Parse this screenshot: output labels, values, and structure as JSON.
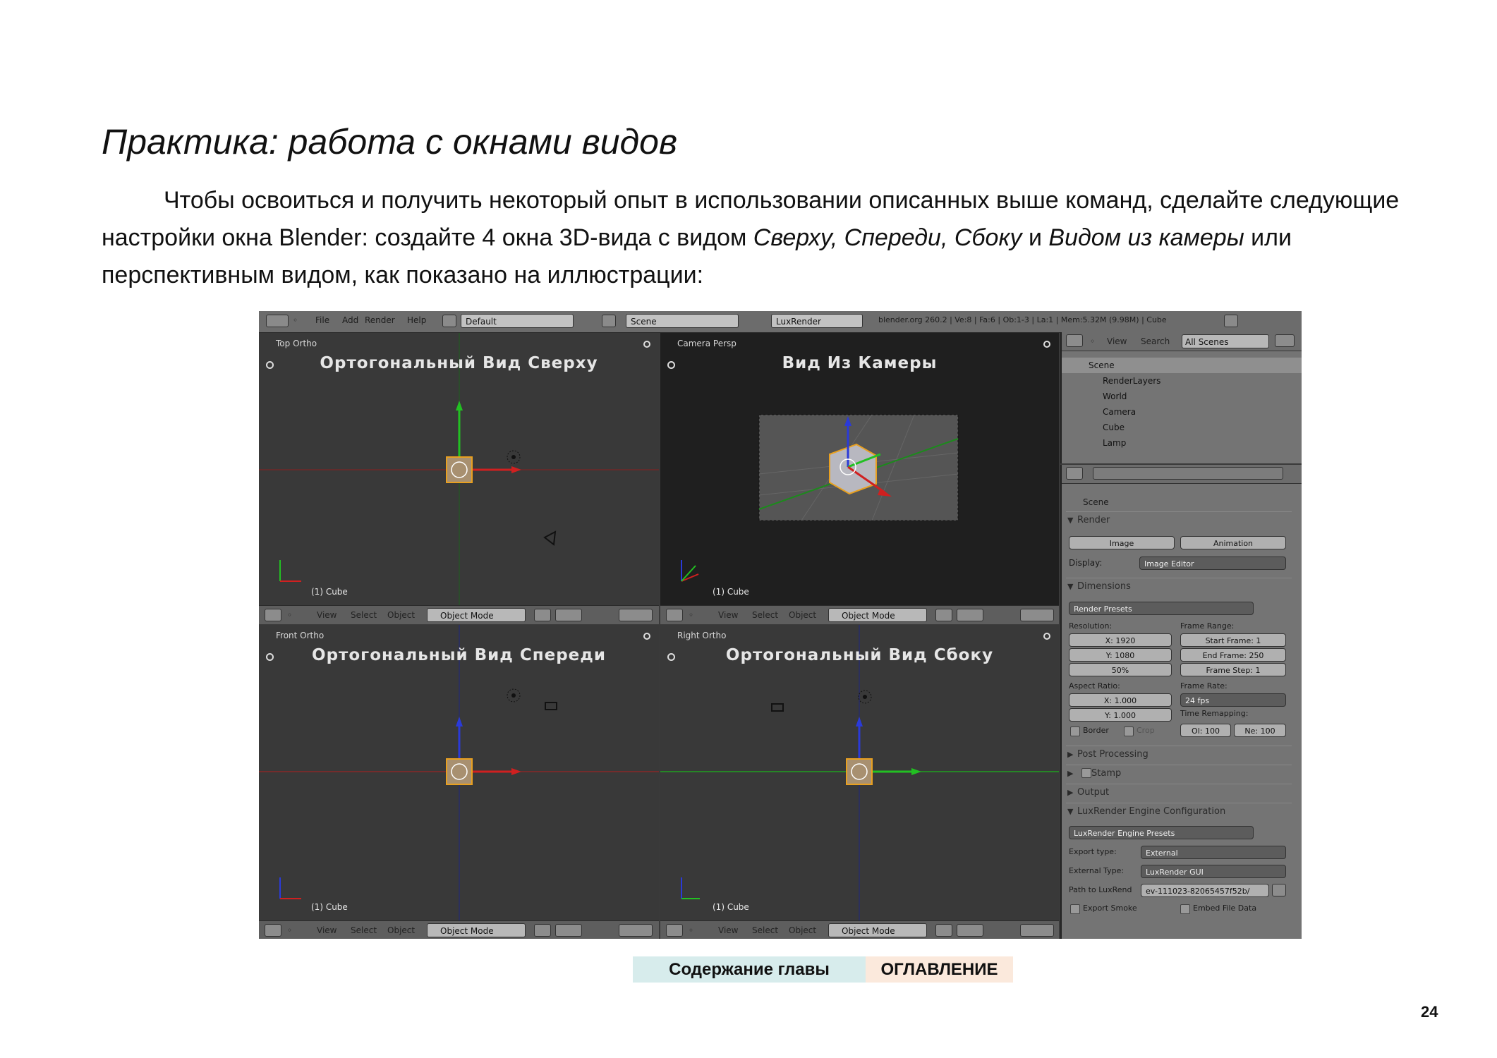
{
  "heading": "Практика: работа с окнами видов",
  "paragraph": {
    "line1": "Чтобы освоиться и получить некоторый опыт в использовании описанных выше команд, сделайте следующие настройки окна Blender: создайте 4 окна 3D-вида с видом ",
    "italic1": "Сверху, Спереди, Сбоку",
    "mid": " и ",
    "italic2": "Видом из камеры",
    "end": " или перспективным видом, как показано на иллюстрации:"
  },
  "blender": {
    "menu": [
      "File",
      "Add",
      "Render",
      "Help"
    ],
    "layout": "Default",
    "scene": "Scene",
    "engine": "LuxRender",
    "stats": "blender.org 260.2 | Ve:8 | Fa:6 | Ob:1-3 | La:1 | Mem:5.32M (9.98M) | Cube",
    "viewports": [
      {
        "label": "Top Ortho",
        "title": "Ортогональный Вид Сверху",
        "object": "(1) Cube"
      },
      {
        "label": "Camera Persp",
        "title": "Вид Из Камеры",
        "object": "(1) Cube"
      },
      {
        "label": "Front Ortho",
        "title": "Ортогональный Вид Спереди",
        "object": "(1) Cube"
      },
      {
        "label": "Right Ortho",
        "title": "Ортогональный Вид Сбоку",
        "object": "(1) Cube"
      }
    ],
    "viewbar": {
      "view": "View",
      "select": "Select",
      "object": "Object",
      "mode": "Object Mode"
    },
    "outliner": {
      "view": "View",
      "search": "Search",
      "filter": "All Scenes",
      "items": [
        "Scene",
        "RenderLayers",
        "World",
        "Camera",
        "Cube",
        "Lamp"
      ]
    },
    "properties": {
      "scene": "Scene",
      "render_section": "Render",
      "image_btn": "Image",
      "animation_btn": "Animation",
      "display_label": "Display:",
      "display_value": "Image Editor",
      "dimensions_section": "Dimensions",
      "render_presets": "Render Presets",
      "resolution_label": "Resolution:",
      "res_x": "X: 1920",
      "res_y": "Y: 1080",
      "res_pct": "50%",
      "frame_range_label": "Frame Range:",
      "start_frame": "Start Frame: 1",
      "end_frame": "End Frame: 250",
      "frame_step": "Frame Step: 1",
      "aspect_label": "Aspect Ratio:",
      "aspect_x": "X: 1.000",
      "aspect_y": "Y: 1.000",
      "frame_rate_label": "Frame Rate:",
      "frame_rate": "24 fps",
      "time_remap_label": "Time Remapping:",
      "remap_old": "Ol: 100",
      "remap_new": "Ne: 100",
      "border": "Border",
      "crop": "Crop",
      "post_processing": "Post Processing",
      "stamp": "Stamp",
      "output": "Output",
      "lux_config": "LuxRender Engine Configuration",
      "lux_presets": "LuxRender Engine Presets",
      "export_type_label": "Export type:",
      "export_type": "External",
      "external_type_label": "External Type:",
      "external_type": "LuxRender GUI",
      "path_label": "Path to LuxRend",
      "path_value": "ev-111023-82065457f52b/",
      "export_smoke": "Export Smoke",
      "embed_file": "Embed File Data"
    }
  },
  "nav": {
    "chapter": "Содержание главы",
    "toc": "ОГЛАВЛЕНИЕ"
  },
  "page_number": "24",
  "colors": {
    "x_axis": "#c81e1e",
    "y_axis": "#1ea01e",
    "z_axis": "#2828d8",
    "nav_chapter_bg": "#d7ecec",
    "nav_toc_bg": "#fbe9dc"
  }
}
